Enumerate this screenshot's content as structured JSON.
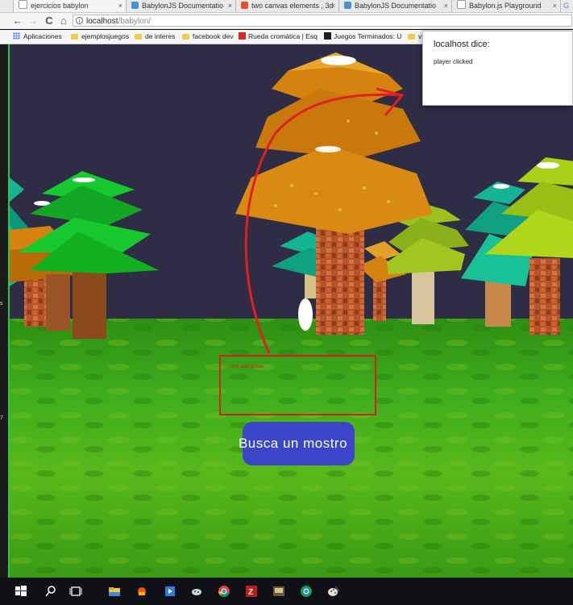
{
  "tabs": [
    {
      "label": "ejercicios babylon",
      "close": "×",
      "icon": "page-icon",
      "active": true
    },
    {
      "label": "BabylonJS Documentatio",
      "close": "×",
      "icon": "babylon-icon"
    },
    {
      "label": "two canvas elements , 3d",
      "close": "×",
      "icon": "html5-icon"
    },
    {
      "label": "BabylonJS Documentatio",
      "close": "×",
      "icon": "babylon-icon"
    },
    {
      "label": "Babylon.js Playground",
      "close": "×",
      "icon": "page-icon"
    },
    {
      "label": "G",
      "close": "",
      "icon": "google-icon"
    }
  ],
  "nav": {
    "back": "←",
    "forward": "→",
    "reload": "C",
    "home": "⌂"
  },
  "address": {
    "host": "localhost",
    "path": "/babylon/",
    "info": "i"
  },
  "bookmarks": [
    {
      "label": "Aplicaciones",
      "icon": "apps-icon"
    },
    {
      "label": "ejemplosjuegos",
      "icon": "folder-icon"
    },
    {
      "label": "de interes",
      "icon": "folder-icon"
    },
    {
      "label": "facebook dev",
      "icon": "folder-icon"
    },
    {
      "label": "Rueda cromática | Esq",
      "icon": "adobe-icon"
    },
    {
      "label": "Juegos Terminados: U",
      "icon": "jt-icon"
    },
    {
      "label": "v",
      "icon": "folder-icon"
    }
  ],
  "left_strip": {
    "mark1": "s",
    "mark2": "7"
  },
  "scene": {
    "hud_text": "click aqui fellow",
    "cta_label": "Busca un mostro"
  },
  "dialog": {
    "title": "localhost dice:",
    "message": "player clicked"
  },
  "taskbar": {
    "icons": [
      "windows-icon",
      "search-icon",
      "task-view-icon",
      "file-explorer-icon",
      "store-icon",
      "media-icon",
      "paint-icon",
      "chrome-icon",
      "filezilla-icon",
      "app-icon",
      "chrome-icon-2",
      "paint-brush-icon"
    ]
  },
  "colors": {
    "sky": "#2f2c46",
    "grass": "#3aa51a",
    "button": "#3c45c8",
    "hud_red": "#d81f1f",
    "tree_orange": "#d5830e",
    "tree_green": "#16c92c",
    "tree_teal": "#14b592",
    "tree_lime": "#a9d11a"
  }
}
